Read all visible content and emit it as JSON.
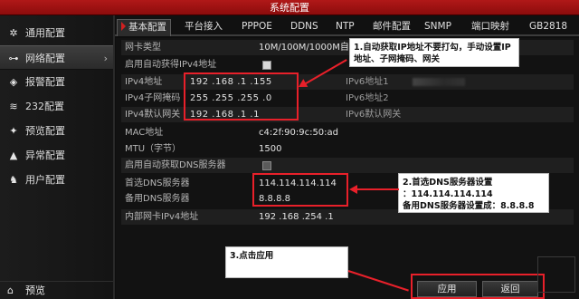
{
  "window": {
    "title": "系统配置"
  },
  "sidebar": {
    "items": [
      {
        "icon": "gear-icon",
        "glyph": "✲",
        "label": "通用配置"
      },
      {
        "icon": "network-icon",
        "glyph": "⊶",
        "label": "网络配置",
        "arrow": "›"
      },
      {
        "icon": "alarm-icon",
        "glyph": "◈",
        "label": "报警配置"
      },
      {
        "icon": "rs232-icon",
        "glyph": "≋",
        "label": "232配置"
      },
      {
        "icon": "preview-icon",
        "glyph": "✦",
        "label": "预览配置"
      },
      {
        "icon": "warning-icon",
        "glyph": "▲",
        "label": "异常配置"
      },
      {
        "icon": "user-icon",
        "glyph": "♞",
        "label": "用户配置"
      }
    ],
    "bottom": {
      "icon": "home-icon",
      "glyph": "⌂",
      "label": "预览"
    }
  },
  "tabs": [
    {
      "label": "基本配置",
      "active": true
    },
    {
      "label": "平台接入"
    },
    {
      "label": "PPPOE"
    },
    {
      "label": "DDNS"
    },
    {
      "label": "NTP"
    },
    {
      "label": "邮件配置"
    },
    {
      "label": "SNMP"
    },
    {
      "label": "端口映射"
    },
    {
      "label": "GB2818"
    }
  ],
  "form": {
    "nic_type": {
      "label": "网卡类型",
      "value": "10M/100M/1000M自"
    },
    "dhcp": {
      "label": "启用自动获得IPv4地址",
      "checked": true
    },
    "ipv4_addr": {
      "label": "IPv4地址",
      "value": "192 .168 .1    .155"
    },
    "ipv4_mask": {
      "label": "IPv4子网掩码",
      "value": "255 .255 .255 .0"
    },
    "ipv4_gw": {
      "label": "IPv4默认网关",
      "value": "192 .168 .1    .1"
    },
    "ipv6_1": {
      "label": "IPv6地址1"
    },
    "ipv6_2": {
      "label": "IPv6地址2"
    },
    "ipv6_gw": {
      "label": "IPv6默认网关"
    },
    "mac": {
      "label": "MAC地址",
      "value": "c4:2f:90:9c:50:ad"
    },
    "mtu": {
      "label": "MTU（字节）",
      "value": "1500"
    },
    "auto_dns": {
      "label": "启用自动获取DNS服务器",
      "checked": false
    },
    "dns_pref": {
      "label": "首选DNS服务器",
      "value": "114.114.114.114"
    },
    "dns_alt": {
      "label": "备用DNS服务器",
      "value": "8.8.8.8"
    },
    "lan_ipv4": {
      "label": "内部网卡IPv4地址",
      "value": "192  .168  .254  .1"
    }
  },
  "callouts": {
    "c1": {
      "line1": "1.自动获取IP地址不要打勾，手动设置IP",
      "line2": "地址、子网掩码、网关"
    },
    "c2": {
      "line1": "2.首选DNS服务器设置",
      "line2": "：114.114.114.114",
      "line3": "备用DNS服务器设置成：8.8.8.8"
    },
    "c3": {
      "line1": "3.点击应用"
    }
  },
  "buttons": {
    "apply": "应用",
    "back": "返回"
  },
  "colors": {
    "title_red": "#b01818",
    "annotation_red": "#e8202a"
  }
}
